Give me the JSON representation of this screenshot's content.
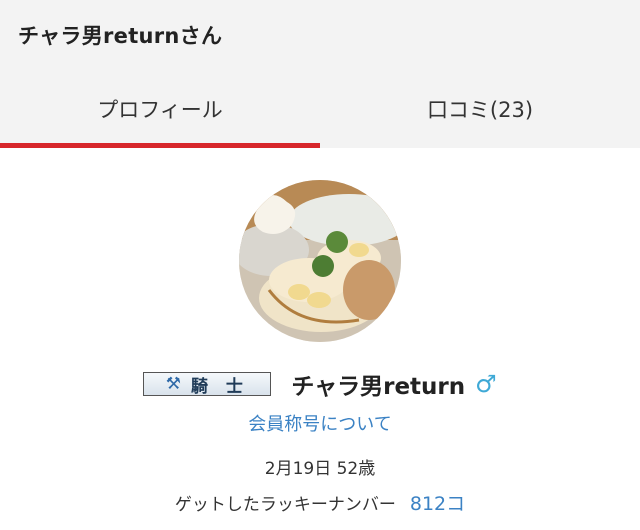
{
  "header": {
    "title": "チャラ男returnさん"
  },
  "tabs": [
    {
      "label": "プロフィール",
      "active": true
    },
    {
      "label": "口コミ(23)",
      "active": false
    }
  ],
  "accent_color": "#d7262b",
  "profile": {
    "avatar_icon": "pancake-photo",
    "rank_icon": "crossed-axes-icon",
    "rank_label": "騎 士",
    "name": "チャラ男return",
    "gender_symbol": "♂",
    "title_link": "会員称号について",
    "birth_age": "2月19日 52歳",
    "lucky_label": "ゲットしたラッキーナンバー",
    "lucky_value": "812コ"
  }
}
